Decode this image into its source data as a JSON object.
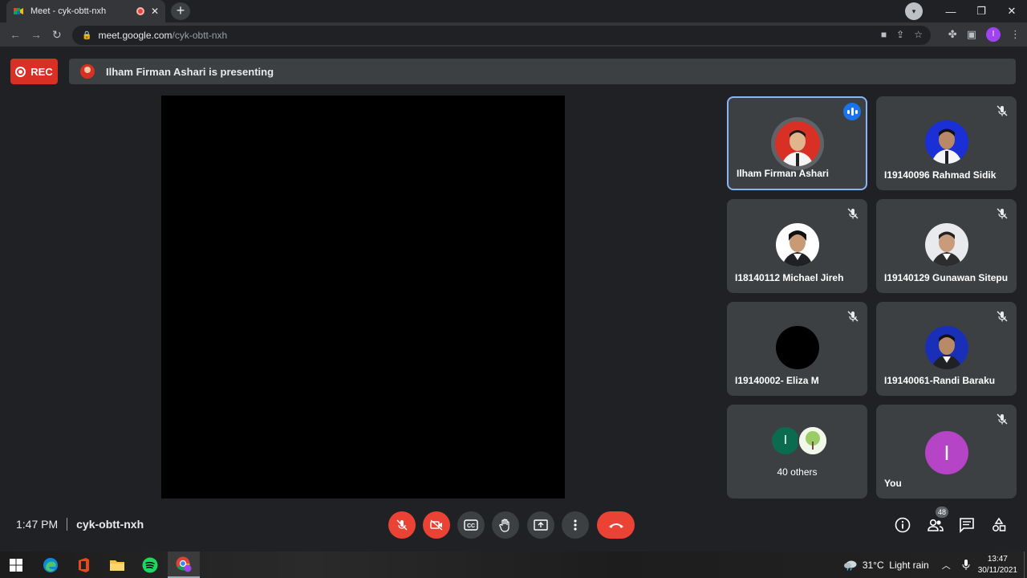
{
  "browser": {
    "tab_title": "Meet - cyk-obtt-nxh",
    "tab_close": "✕",
    "new_tab": "+",
    "url_host": "meet.google.com",
    "url_path": "/cyk-obtt-nxh",
    "profile_initial": "I",
    "window_controls": {
      "minimize": "—",
      "maximize": "❐",
      "close": "✕"
    }
  },
  "meet": {
    "rec_label": "REC",
    "presenting_text": "Ilham Firman Ashari is presenting",
    "participants": [
      {
        "name": "Ilham Firman Ashari",
        "speaking": true,
        "bg": "#d93025",
        "shirt": "#ffffff"
      },
      {
        "name": "I19140096 Rahmad Sidik",
        "muted": true,
        "bg": "#1a2fd6",
        "shirt": "#ffffff"
      },
      {
        "name": "I18140112 Michael Jireh",
        "muted": true,
        "bg": "#ffffff",
        "shirt": "#ffffff"
      },
      {
        "name": "I19140129 Gunawan Sitepu",
        "muted": true,
        "bg": "#e8eaed",
        "shirt": "#ffffff"
      },
      {
        "name": "I19140002- Eliza M",
        "muted": true,
        "bg": "#000000"
      },
      {
        "name": "I19140061-Randi Baraku",
        "muted": true,
        "bg": "#1a2fb8",
        "shirt": "#ffffff"
      }
    ],
    "others": {
      "initial": "I",
      "label": "40 others"
    },
    "you": {
      "initial": "I",
      "label": "You"
    },
    "time": "1:47 PM",
    "meeting_code": "cyk-obtt-nxh",
    "people_count": "48"
  },
  "taskbar": {
    "weather": "31°C  Light rain",
    "clock_time": "13:47",
    "clock_date": "30/11/2021"
  }
}
